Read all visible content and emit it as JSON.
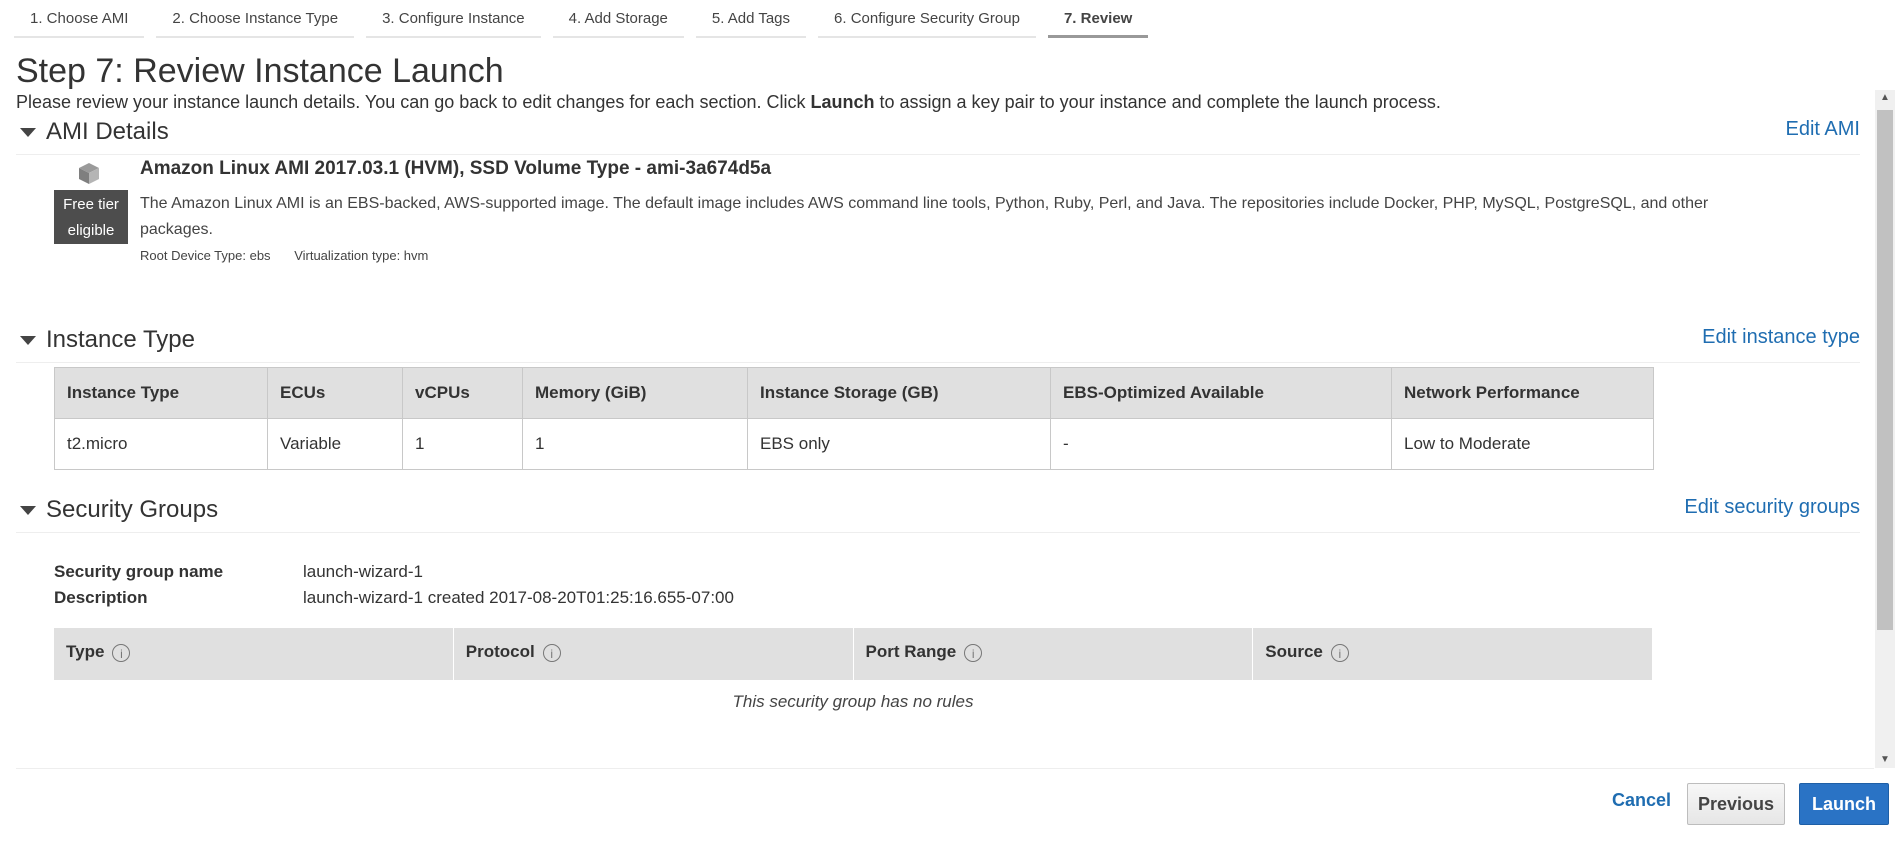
{
  "wizard_tabs": [
    {
      "label": "1. Choose AMI"
    },
    {
      "label": "2. Choose Instance Type"
    },
    {
      "label": "3. Configure Instance"
    },
    {
      "label": "4. Add Storage"
    },
    {
      "label": "5. Add Tags"
    },
    {
      "label": "6. Configure Security Group"
    },
    {
      "label": "7. Review",
      "active": true
    }
  ],
  "page": {
    "title": "Step 7: Review Instance Launch",
    "intro_before": "Please review your instance launch details. You can go back to edit changes for each section. Click ",
    "intro_bold": "Launch",
    "intro_after": " to assign a key pair to your instance and complete the launch process."
  },
  "ami_section": {
    "title": "AMI Details",
    "edit_label": "Edit AMI",
    "badge_line1": "Free tier",
    "badge_line2": "eligible",
    "name": "Amazon Linux AMI 2017.03.1 (HVM), SSD Volume Type - ami-3a674d5a",
    "description": "The Amazon Linux AMI is an EBS-backed, AWS-supported image. The default image includes AWS command line tools, Python, Ruby, Perl, and Java. The repositories include Docker, PHP, MySQL, PostgreSQL, and other packages.",
    "root_device": "Root Device Type: ebs",
    "virtualization": "Virtualization type: hvm"
  },
  "instance_section": {
    "title": "Instance Type",
    "edit_label": "Edit instance type",
    "headers": [
      "Instance Type",
      "ECUs",
      "vCPUs",
      "Memory (GiB)",
      "Instance Storage (GB)",
      "EBS-Optimized Available",
      "Network Performance"
    ],
    "row": [
      "t2.micro",
      "Variable",
      "1",
      "1",
      "EBS only",
      "-",
      "Low to Moderate"
    ]
  },
  "security_section": {
    "title": "Security Groups",
    "edit_label": "Edit security groups",
    "name_label": "Security group name",
    "name_value": "launch-wizard-1",
    "desc_label": "Description",
    "desc_value": "launch-wizard-1 created 2017-08-20T01:25:16.655-07:00",
    "rule_headers": [
      "Type",
      "Protocol",
      "Port Range",
      "Source"
    ],
    "empty_message": "This security group has no rules"
  },
  "footer": {
    "cancel_label": "Cancel",
    "previous_label": "Previous",
    "launch_label": "Launch"
  },
  "colors": {
    "link": "#1f6db1",
    "launch_button": "#2a73c5",
    "badge": "#4d4d4d"
  }
}
